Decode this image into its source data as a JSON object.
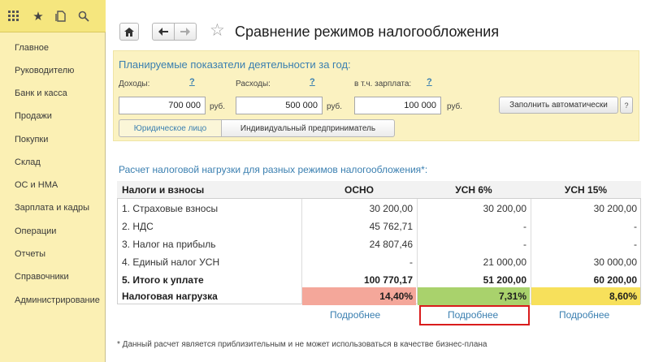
{
  "sidebar": {
    "toolbar_icons": [
      "grid-icon",
      "star-icon",
      "history-icon",
      "search-icon"
    ],
    "items": [
      {
        "label": "Главное"
      },
      {
        "label": "Руководителю"
      },
      {
        "label": "Банк и касса"
      },
      {
        "label": "Продажи"
      },
      {
        "label": "Покупки"
      },
      {
        "label": "Склад"
      },
      {
        "label": "ОС и НМА"
      },
      {
        "label": "Зарплата и кадры"
      },
      {
        "label": "Операции"
      },
      {
        "label": "Отчеты"
      },
      {
        "label": "Справочники"
      },
      {
        "label": "Администрирование"
      }
    ]
  },
  "header": {
    "title": "Сравнение режимов налогообложения",
    "home_icon": "home-icon",
    "back_icon": "arrow-left-icon",
    "forward_icon": "arrow-right-icon",
    "favorite_icon": "star-outline-icon"
  },
  "params": {
    "title": "Планируемые показатели деятельности за год:",
    "income_label": "Доходы:",
    "income_value": "700 000",
    "expenses_label": "Расходы:",
    "expenses_value": "500 000",
    "salary_label": "в т.ч. зарплата:",
    "salary_value": "100 000",
    "unit": "руб.",
    "help": "?",
    "fill_button": "Заполнить автоматически",
    "fill_dropdown": "?",
    "entity_types": [
      "Юридическое лицо",
      "Индивидуальный предприниматель"
    ],
    "selected_entity": "Юридическое лицо"
  },
  "calc": {
    "title": "Расчет налоговой нагрузки для разных режимов налогообложения*:",
    "columns": [
      "Налоги и взносы",
      "ОСНО",
      "УСН 6%",
      "УСН 15%"
    ],
    "rows": [
      [
        "1. Страховые взносы",
        "30 200,00",
        "30 200,00",
        "30 200,00"
      ],
      [
        "2. НДС",
        "45 762,71",
        "-",
        "-"
      ],
      [
        "3. Налог на прибыль",
        "24 807,46",
        "-",
        "-"
      ],
      [
        "4. Единый налог УСН",
        "-",
        "21 000,00",
        "30 000,00"
      ],
      [
        "5. Итого к уплате",
        "100 770,17",
        "51 200,00",
        "60 200,00"
      ]
    ],
    "burden_label": "Налоговая нагрузка",
    "burden_values": [
      "14,40%",
      "7,31%",
      "8,60%"
    ],
    "burden_colors": [
      "#f4a79a",
      "#a9d26c",
      "#f7e05b"
    ],
    "details_link": "Подробнее"
  },
  "footnote": "* Данный расчет является приблизительным и не может использоваться в качестве бизнес-плана"
}
